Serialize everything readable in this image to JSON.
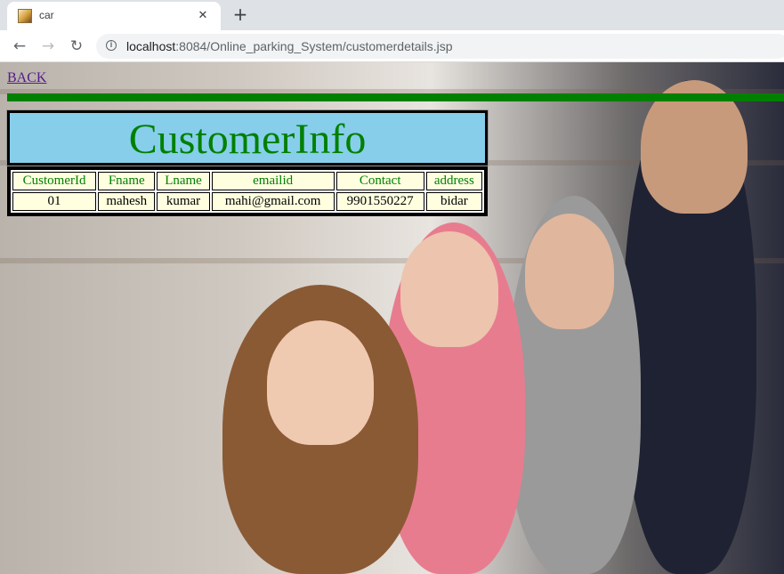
{
  "browser": {
    "tab_title": "car",
    "tab_close": "✕",
    "new_tab": "+",
    "url_host": "localhost",
    "url_rest": ":8084/Online_parking_System/customerdetails.jsp"
  },
  "page": {
    "back_label": "BACK",
    "title": "CustomerInfo",
    "table": {
      "headers": [
        "CustomerId",
        "Fname",
        "Lname",
        "emailid",
        "Contact",
        "address"
      ],
      "rows": [
        [
          "01",
          "mahesh",
          "kumar",
          "mahi@gmail.com",
          "9901550227",
          "bidar"
        ]
      ]
    }
  },
  "colors": {
    "accent_green": "#008000",
    "title_bg": "#87ceeb",
    "cell_bg": "#ffffe0"
  }
}
